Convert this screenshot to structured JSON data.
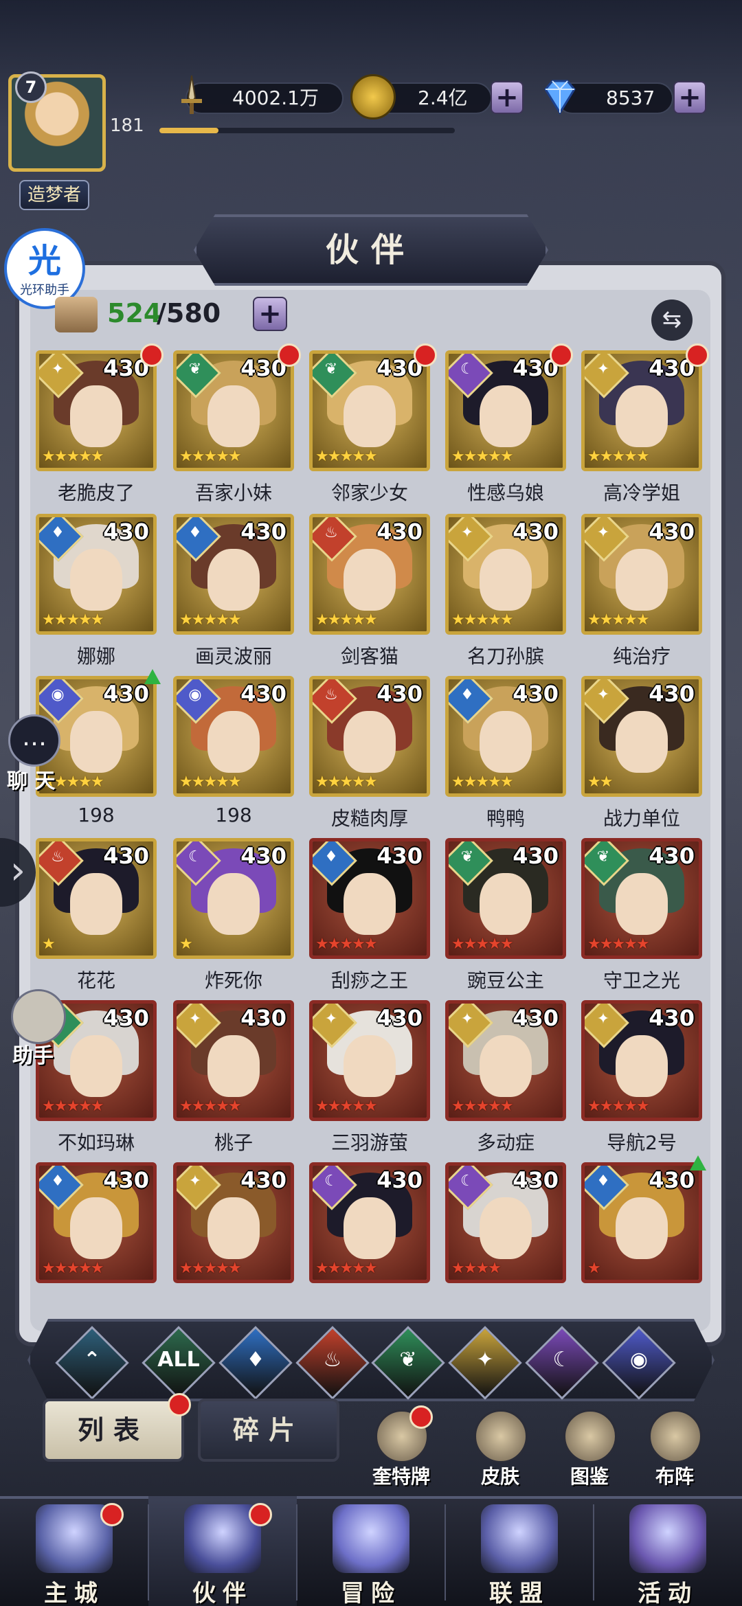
{
  "player": {
    "level": "7",
    "exp": "181",
    "exp_progress": 0.2,
    "rank_title": "造梦者"
  },
  "resources": [
    {
      "name": "power",
      "icon": "sword-icon",
      "value": "4002.1万"
    },
    {
      "name": "gold",
      "icon": "gold-coin-icon",
      "value": "2.4亿"
    },
    {
      "name": "diamond",
      "icon": "diamond-icon",
      "value": "8537"
    }
  ],
  "assistant": {
    "main": "光",
    "sub": "光环助手"
  },
  "side": {
    "chat": "聊 天",
    "helper": "助手",
    "chat_glyph": "…",
    "arrow": "›"
  },
  "title": "伙伴",
  "count": {
    "current": "524",
    "max": "/580"
  },
  "plus_glyph": "+",
  "swap_glyph": "⇆",
  "heroes": [
    {
      "name": "老脆皮了",
      "level": "430",
      "element": "light",
      "frame": "gold",
      "stars": 5,
      "star_color": "gold",
      "badge": "red-dot"
    },
    {
      "name": "吾家小妹",
      "level": "430",
      "element": "nature",
      "frame": "gold",
      "stars": 5,
      "star_color": "gold",
      "badge": "red-dot"
    },
    {
      "name": "邻家少女",
      "level": "430",
      "element": "nature",
      "frame": "gold",
      "stars": 5,
      "star_color": "gold",
      "badge": "red-dot"
    },
    {
      "name": "性感乌娘",
      "level": "430",
      "element": "dark",
      "frame": "gold",
      "stars": 5,
      "star_color": "gold",
      "badge": "red-dot"
    },
    {
      "name": "高冷学姐",
      "level": "430",
      "element": "light",
      "frame": "gold",
      "stars": 5,
      "star_color": "gold",
      "badge": "red-dot"
    },
    {
      "name": "娜娜",
      "level": "430",
      "element": "water",
      "frame": "gold",
      "stars": 5,
      "star_color": "gold",
      "badge": ""
    },
    {
      "name": "画灵波丽",
      "level": "430",
      "element": "water",
      "frame": "gold",
      "stars": 5,
      "star_color": "gold",
      "badge": ""
    },
    {
      "name": "剑客猫",
      "level": "430",
      "element": "fire",
      "frame": "gold",
      "stars": 5,
      "star_color": "gold",
      "badge": ""
    },
    {
      "name": "名刀孙膑",
      "level": "430",
      "element": "light",
      "frame": "gold",
      "stars": 5,
      "star_color": "gold",
      "badge": ""
    },
    {
      "name": "纯治疗",
      "level": "430",
      "element": "light",
      "frame": "gold",
      "stars": 5,
      "star_color": "gold",
      "badge": ""
    },
    {
      "name": "198",
      "level": "430",
      "element": "cosmic",
      "frame": "gold",
      "stars": 5,
      "star_color": "gold",
      "badge": "up-arrow"
    },
    {
      "name": "198",
      "level": "430",
      "element": "cosmic",
      "frame": "gold",
      "stars": 5,
      "star_color": "gold",
      "badge": ""
    },
    {
      "name": "皮糙肉厚",
      "level": "430",
      "element": "fire",
      "frame": "gold",
      "stars": 5,
      "star_color": "gold",
      "badge": ""
    },
    {
      "name": "鸭鸭",
      "level": "430",
      "element": "water",
      "frame": "gold",
      "stars": 5,
      "star_color": "gold",
      "badge": ""
    },
    {
      "name": "战力单位",
      "level": "430",
      "element": "light",
      "frame": "gold",
      "stars": 2,
      "star_color": "gold",
      "badge": ""
    },
    {
      "name": "花花",
      "level": "430",
      "element": "fire",
      "frame": "gold",
      "stars": 1,
      "star_color": "gold",
      "badge": ""
    },
    {
      "name": "炸死你",
      "level": "430",
      "element": "dark",
      "frame": "gold",
      "stars": 1,
      "star_color": "gold",
      "badge": ""
    },
    {
      "name": "刮痧之王",
      "level": "430",
      "element": "water",
      "frame": "red",
      "stars": 5,
      "star_color": "red",
      "badge": ""
    },
    {
      "name": "豌豆公主",
      "level": "430",
      "element": "nature",
      "frame": "red",
      "stars": 5,
      "star_color": "red",
      "badge": ""
    },
    {
      "name": "守卫之光",
      "level": "430",
      "element": "nature",
      "frame": "red",
      "stars": 5,
      "star_color": "red",
      "badge": ""
    },
    {
      "name": "不如玛琳",
      "level": "430",
      "element": "nature",
      "frame": "red",
      "stars": 5,
      "star_color": "red",
      "badge": ""
    },
    {
      "name": "桃子",
      "level": "430",
      "element": "light",
      "frame": "red",
      "stars": 5,
      "star_color": "red",
      "badge": ""
    },
    {
      "name": "三羽游萤",
      "level": "430",
      "element": "light",
      "frame": "red",
      "stars": 5,
      "star_color": "red",
      "badge": ""
    },
    {
      "name": "多动症",
      "level": "430",
      "element": "light",
      "frame": "red",
      "stars": 5,
      "star_color": "red",
      "badge": ""
    },
    {
      "name": "导航2号",
      "level": "430",
      "element": "light",
      "frame": "red",
      "stars": 5,
      "star_color": "red",
      "badge": ""
    },
    {
      "name": "",
      "level": "430",
      "element": "water",
      "frame": "red",
      "stars": 5,
      "star_color": "red",
      "badge": ""
    },
    {
      "name": "",
      "level": "430",
      "element": "light",
      "frame": "red",
      "stars": 5,
      "star_color": "red",
      "badge": ""
    },
    {
      "name": "",
      "level": "430",
      "element": "dark",
      "frame": "red",
      "stars": 5,
      "star_color": "red",
      "badge": ""
    },
    {
      "name": "",
      "level": "430",
      "element": "dark",
      "frame": "red",
      "stars": 4,
      "star_color": "red",
      "badge": ""
    },
    {
      "name": "",
      "level": "430",
      "element": "water",
      "frame": "red",
      "stars": 1,
      "star_color": "red",
      "badge": "up-arrow"
    }
  ],
  "element_colors": {
    "light": "#c9a43c",
    "nature": "#2f8f5a",
    "dark": "#7b4ab8",
    "water": "#2f6fc2",
    "fire": "#c2412c",
    "cosmic": "#4f5ac9",
    "ice": "#3a7a9a"
  },
  "element_glyphs": {
    "light": "✦",
    "nature": "❦",
    "dark": "☾",
    "water": "♦",
    "fire": "♨",
    "cosmic": "◉",
    "ice": "⌃"
  },
  "filters": [
    {
      "key": "ice",
      "label": "",
      "color": "#2e5f7a"
    },
    {
      "key": "all",
      "label": "ALL",
      "color": "#2d6a4d"
    },
    {
      "key": "water",
      "label": "",
      "color": "#2f6fc2"
    },
    {
      "key": "fire",
      "label": "",
      "color": "#c2412c"
    },
    {
      "key": "nature",
      "label": "",
      "color": "#2f8f5a"
    },
    {
      "key": "light",
      "label": "",
      "color": "#c9a43c"
    },
    {
      "key": "dark",
      "label": "",
      "color": "#7b4ab8"
    },
    {
      "key": "cosmic",
      "label": "",
      "color": "#4f5ac9"
    }
  ],
  "tabs": {
    "list": "列表",
    "fragments": "碎片"
  },
  "functions": [
    {
      "key": "tarot",
      "label": "奎特牌",
      "badge": true
    },
    {
      "key": "skins",
      "label": "皮肤",
      "badge": false
    },
    {
      "key": "codex",
      "label": "图鉴",
      "badge": false
    },
    {
      "key": "formation",
      "label": "布阵",
      "badge": false
    }
  ],
  "nav": [
    {
      "key": "city",
      "label": "主城",
      "badge": true,
      "color": "#5a63a8"
    },
    {
      "key": "partners",
      "label": "伙伴",
      "badge": true,
      "color": "#4a4f9a"
    },
    {
      "key": "adventure",
      "label": "冒险",
      "badge": false,
      "color": "#6d6fc8"
    },
    {
      "key": "alliance",
      "label": "联盟",
      "badge": false,
      "color": "#5b5fa8"
    },
    {
      "key": "events",
      "label": "活动",
      "badge": false,
      "color": "#6b58b0"
    }
  ]
}
